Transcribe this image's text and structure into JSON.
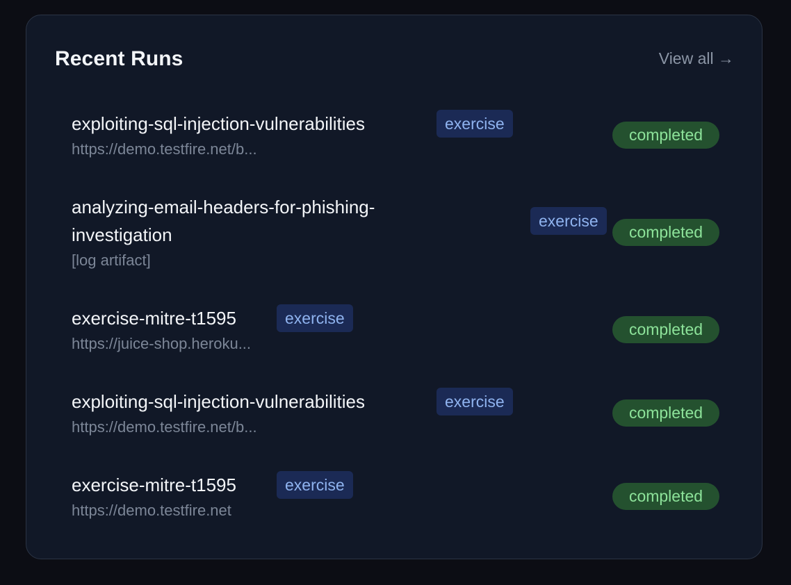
{
  "panel": {
    "title": "Recent Runs",
    "view_all_label": "View all →"
  },
  "runs": [
    {
      "name": "exploiting-sql-injection-vulnerabilities",
      "target": "https://demo.testfire.net/b...",
      "tag": "exercise",
      "status": "completed"
    },
    {
      "name": "analyzing-email-headers-for-phishing-investigation",
      "target": "[log artifact]",
      "tag": "exercise",
      "status": "completed"
    },
    {
      "name": "exercise-mitre-t1595",
      "target": "https://juice-shop.heroku...",
      "tag": "exercise",
      "status": "completed"
    },
    {
      "name": "exploiting-sql-injection-vulnerabilities",
      "target": "https://demo.testfire.net/b...",
      "tag": "exercise",
      "status": "completed"
    },
    {
      "name": "exercise-mitre-t1595",
      "target": "https://demo.testfire.net",
      "tag": "exercise",
      "status": "completed"
    }
  ],
  "colors": {
    "background": "#0c0d14",
    "card": "#111827",
    "tag_bg": "#1b2a55",
    "tag_text": "#8fb3ef",
    "status_bg": "#24512f",
    "status_text": "#8de39a"
  }
}
